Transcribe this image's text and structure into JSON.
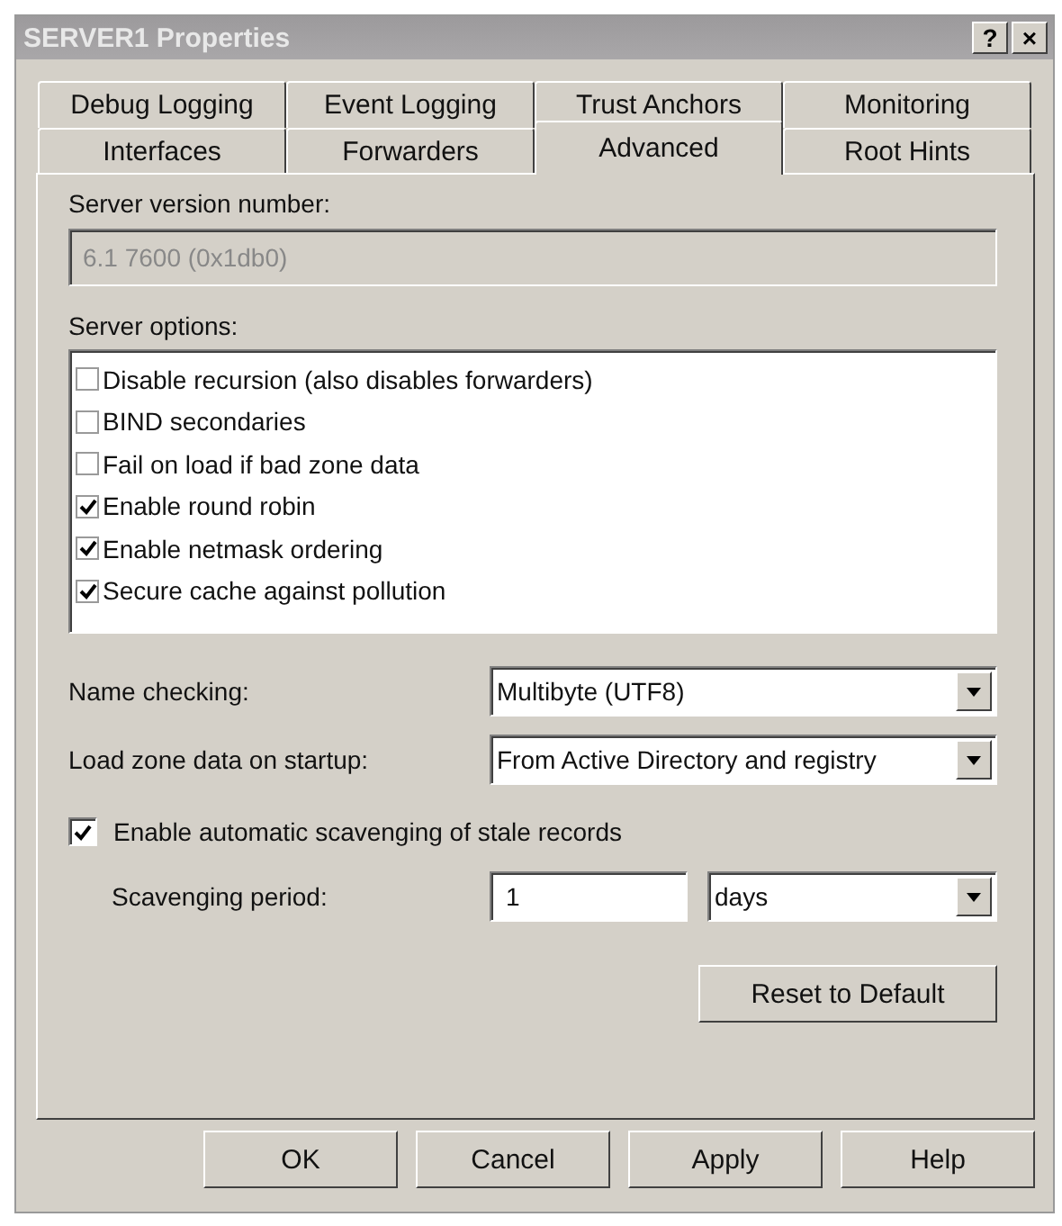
{
  "window": {
    "title": "SERVER1 Properties",
    "title_buttons": [
      "?",
      "×"
    ]
  },
  "tab_rows": [
    [
      {
        "label": "Debug Logging",
        "selected": false
      },
      {
        "label": "Event Logging",
        "selected": false
      },
      {
        "label": "Trust Anchors",
        "selected": false
      },
      {
        "label": "Monitoring",
        "selected": false
      }
    ],
    [
      {
        "label": "Interfaces",
        "selected": false
      },
      {
        "label": "Forwarders",
        "selected": false
      },
      {
        "label": "Advanced",
        "selected": true
      },
      {
        "label": "Root Hints",
        "selected": false
      }
    ]
  ],
  "version": {
    "label": "Server version number:",
    "value": "6.1 7600 (0x1db0)",
    "disabled": true
  },
  "options": {
    "label": "Server options:",
    "items": [
      {
        "label": "Disable recursion (also disables forwarders)",
        "checked": false
      },
      {
        "label": "BIND secondaries",
        "checked": false
      },
      {
        "label": "Fail on load if bad zone data",
        "checked": false
      },
      {
        "label": "Enable round robin",
        "checked": true
      },
      {
        "label": "Enable netmask ordering",
        "checked": true
      },
      {
        "label": "Secure cache against pollution",
        "checked": true
      }
    ]
  },
  "name_checking": {
    "label": "Name checking:",
    "value": "Multibyte (UTF8)"
  },
  "load_zone": {
    "label": "Load zone data on startup:",
    "value": "From Active Directory and registry"
  },
  "scavenging": {
    "label": "Enable automatic scavenging of stale records",
    "checked": true,
    "period_label": "Scavenging period:",
    "period": "1",
    "unit": "days"
  },
  "reset_button": "Reset to Default",
  "buttons": [
    "OK",
    "Cancel",
    "Apply",
    "Help"
  ]
}
